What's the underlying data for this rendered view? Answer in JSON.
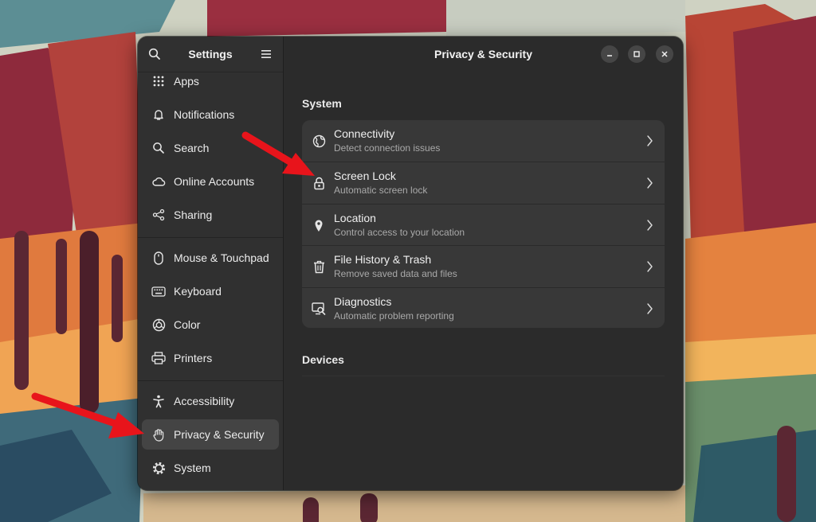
{
  "colors": {
    "accent_arrow": "#e8141b",
    "window_bg": "#2b2b2b",
    "sidebar_bg": "#303030",
    "row_bg": "#383838"
  },
  "sidebar": {
    "title": "Settings",
    "search_icon": "search-icon",
    "menu_icon": "hamburger-menu-icon",
    "items": [
      {
        "label": "Apps",
        "icon": "apps-grid-icon"
      },
      {
        "label": "Notifications",
        "icon": "bell-icon"
      },
      {
        "label": "Search",
        "icon": "search-icon"
      },
      {
        "label": "Online Accounts",
        "icon": "cloud-icon"
      },
      {
        "label": "Sharing",
        "icon": "share-icon"
      },
      {
        "label": "Mouse & Touchpad",
        "icon": "mouse-icon"
      },
      {
        "label": "Keyboard",
        "icon": "keyboard-icon"
      },
      {
        "label": "Color",
        "icon": "color-icon"
      },
      {
        "label": "Printers",
        "icon": "printer-icon"
      },
      {
        "label": "Accessibility",
        "icon": "accessibility-icon"
      },
      {
        "label": "Privacy & Security",
        "icon": "hand-icon",
        "selected": true
      },
      {
        "label": "System",
        "icon": "gear-icon"
      }
    ]
  },
  "header": {
    "title": "Privacy & Security",
    "window_controls": [
      "minimize-icon",
      "maximize-icon",
      "close-icon"
    ]
  },
  "main": {
    "system_section": {
      "label": "System",
      "rows": [
        {
          "title": "Connectivity",
          "subtitle": "Detect connection issues",
          "icon": "globe-icon"
        },
        {
          "title": "Screen Lock",
          "subtitle": "Automatic screen lock",
          "icon": "lock-icon"
        },
        {
          "title": "Location",
          "subtitle": "Control access to your location",
          "icon": "location-pin-icon"
        },
        {
          "title": "File History & Trash",
          "subtitle": "Remove saved data and files",
          "icon": "trash-icon"
        },
        {
          "title": "Diagnostics",
          "subtitle": "Automatic problem reporting",
          "icon": "diagnostics-icon"
        }
      ]
    },
    "devices_section": {
      "label": "Devices"
    }
  },
  "annotations": [
    "arrow-to-screen-lock",
    "arrow-to-privacy-security"
  ]
}
